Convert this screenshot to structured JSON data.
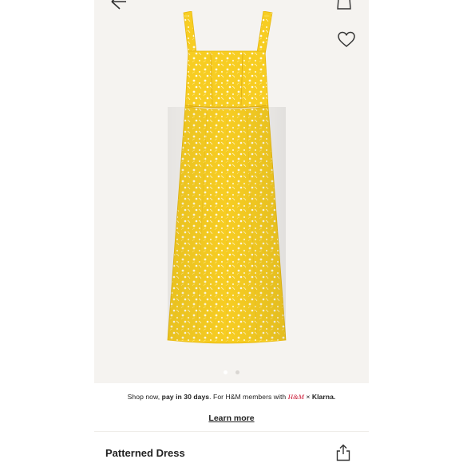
{
  "payment": {
    "prefix": "Shop now, ",
    "highlight": "pay in 30 days",
    "middle": ". For H&M members with ",
    "brand": "H&M",
    "times": " × ",
    "partner": "Klarna.",
    "learn_more": "Learn more"
  },
  "product": {
    "title": "Patterned Dress"
  },
  "carousel": {
    "total": 2,
    "active": 1
  },
  "icons": {
    "back": "arrow-left-icon",
    "bag": "shopping-bag-icon",
    "favorite": "heart-icon",
    "share": "share-icon"
  },
  "colors": {
    "dress": "#f7cf27",
    "background": "#f5f3f0"
  }
}
